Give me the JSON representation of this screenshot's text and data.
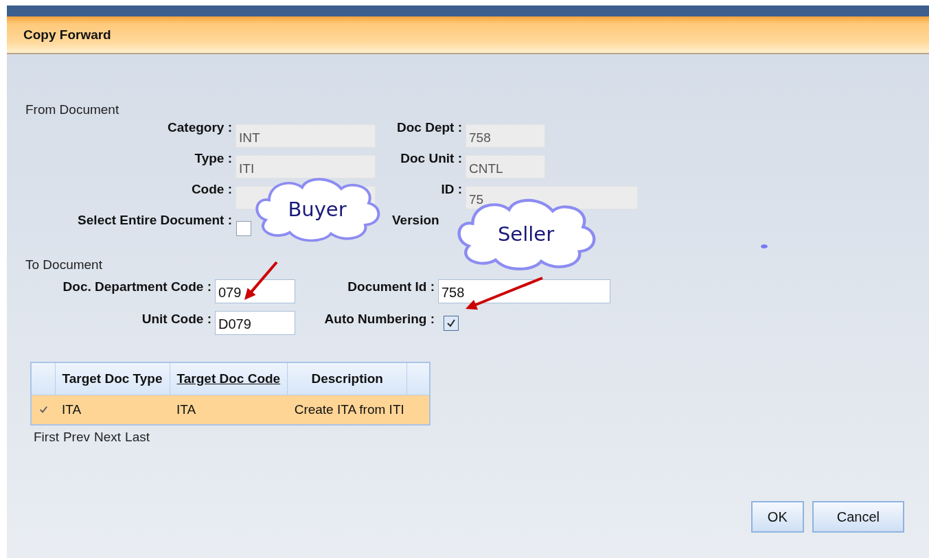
{
  "dialog": {
    "title": "Copy Forward"
  },
  "from_document": {
    "heading": "From Document",
    "rows": [
      [
        {
          "label": "Category :",
          "value": "INT"
        },
        {
          "label": "Doc Dept :",
          "value": "758"
        }
      ],
      [
        {
          "label": "Type :",
          "value": "ITI"
        },
        {
          "label": "Doc Unit :",
          "value": "CNTL"
        }
      ],
      [
        {
          "label": "Code :"
        },
        {
          "label": "ID :",
          "value": "75"
        }
      ]
    ],
    "select_entire_document": {
      "label": "Select Entire Document :",
      "checked": false
    },
    "version": {
      "label": "Version"
    }
  },
  "callouts": [
    {
      "text": "Buyer"
    },
    {
      "text": "Seller"
    }
  ],
  "to_document": {
    "heading": "To Document",
    "department_code": {
      "label": "Doc. Department Code :",
      "value": "079"
    },
    "document_id": {
      "label": "Document Id :",
      "value": "758"
    },
    "unit_code": {
      "label": "Unit Code :",
      "value": "D079"
    },
    "auto_numbering": {
      "label": "Auto Numbering :",
      "checked": true
    }
  },
  "table": {
    "columns": [
      {
        "label": "Target Doc Type",
        "sorted": false
      },
      {
        "label": "Target Doc Code",
        "sorted": true
      },
      {
        "label": "Description",
        "sorted": false
      }
    ],
    "rows": [
      {
        "selected": true,
        "cells": [
          "ITA",
          "ITA",
          "Create ITA from ITI"
        ]
      }
    ]
  },
  "pager": [
    "First",
    "Prev",
    "Next",
    "Last"
  ],
  "buttons": [
    "OK",
    "Cancel"
  ]
}
